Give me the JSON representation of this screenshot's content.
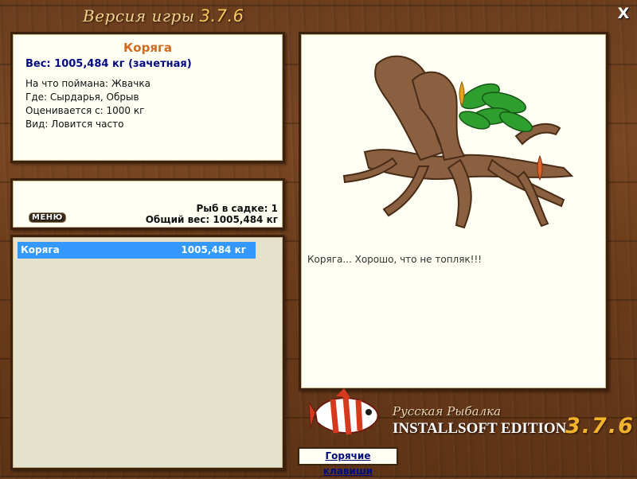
{
  "window": {
    "title": "Версия игры",
    "version": "3.7.6",
    "close_label": "X"
  },
  "fish_info": {
    "name": "Коряга",
    "weight": "Вес: 1005,484 кг (зачетная)",
    "lines": [
      "На что поймана: Жвачка",
      "Где: Сырдарья, Обрыв",
      "Оценивается с: 1000 кг",
      "Вид: Ловится часто"
    ]
  },
  "summary": {
    "menu_label": "МЕНЮ",
    "count_text": "Рыб в садке: 1",
    "total_text": "Общий вес: 1005,484 кг"
  },
  "catch_list": [
    {
      "name": "Коряга",
      "weight": "1005,484 кг",
      "selected": true
    }
  ],
  "preview": {
    "comment": "Коряга... Хорошо, что не топляк!!!"
  },
  "brand": {
    "subtitle": "Русская Рыбалка",
    "edition": "INSTALLSOFT EDITION",
    "version": "3.7.6"
  },
  "hotkeys_label": "Горячие клавиши",
  "colors": {
    "selected_row": "#3399ff",
    "fish_name": "#d2691e",
    "weight_text": "#000a80"
  }
}
